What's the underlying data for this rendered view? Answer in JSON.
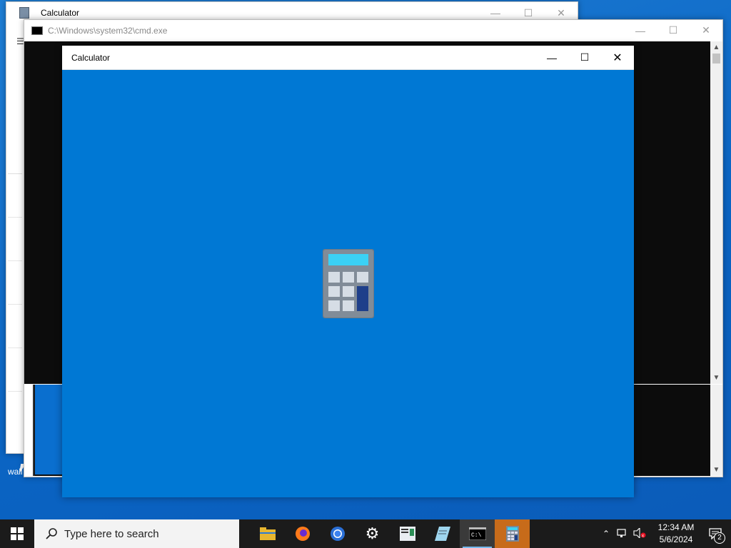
{
  "back_window": {
    "title": "Calculator",
    "left_fragment": "wall"
  },
  "cmd_window": {
    "title": "C:\\Windows\\system32\\cmd.exe"
  },
  "calc_window": {
    "title": "Calculator"
  },
  "taskbar": {
    "search_placeholder": "Type here to search",
    "apps": [
      "file-explorer-icon",
      "firefox-icon",
      "chrome-icon",
      "settings-icon",
      "wordpad-icon",
      "notepad-icon",
      "cmd-icon",
      "calculator-icon"
    ],
    "clock_time": "12:34 AM",
    "clock_date": "5/6/2024",
    "notification_count": "2"
  },
  "colors": {
    "calc_splash_bg": "#0078d4",
    "taskbar_bg": "#1b1b1b",
    "active_indicator": "#76b9ed",
    "calc_taskbar_active": "#c76b1a"
  }
}
